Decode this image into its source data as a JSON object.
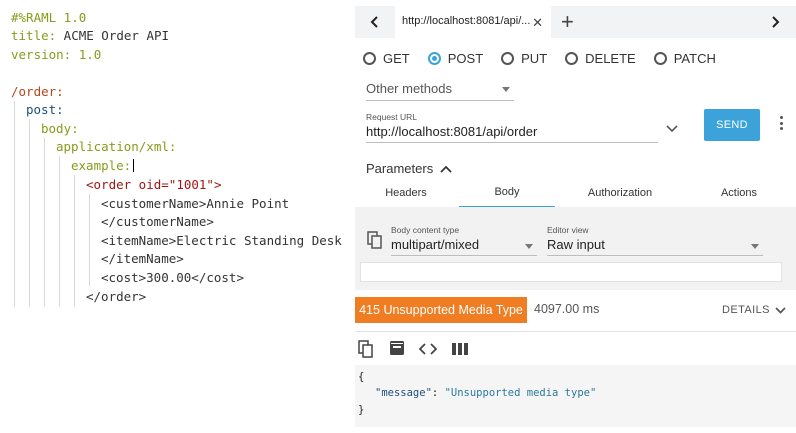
{
  "editor": {
    "lines": {
      "l1": "#%RAML 1.0",
      "l2_key": "title:",
      "l2_val": " ACME Order API",
      "l3_key": "version:",
      "l3_val": " 1.0",
      "l5": "/order:",
      "l6": "post:",
      "l7": "body:",
      "l8": "application/xml:",
      "l9": "example:",
      "l10_tag": "<order",
      "l10_attr": " oid=",
      "l10_val": "\"1001\">",
      "l11": "<customerName>Annie Point",
      "l12": "</customerName>",
      "l13": "<itemName>Electric Standing Desk",
      "l14": "</itemName>",
      "l15": "<cost>300.00</cost>",
      "l16": "</order>"
    }
  },
  "browser": {
    "tab_title": "http://localhost:8081/api/...",
    "tab_close": "✕",
    "new_tab": "+"
  },
  "request": {
    "methods": [
      "GET",
      "POST",
      "PUT",
      "DELETE",
      "PATCH"
    ],
    "selected_method": "POST",
    "other_methods": "Other methods",
    "url_label": "Request URL",
    "url": "http://localhost:8081/api/order",
    "send": "SEND",
    "parameters": "Parameters",
    "tabs": [
      "Headers",
      "Body",
      "Authorization",
      "Actions"
    ],
    "active_tab": "Body",
    "body_content_type_label": "Body content type",
    "body_content_type": "multipart/mixed",
    "editor_view_label": "Editor view",
    "editor_view": "Raw input"
  },
  "response": {
    "status": "415 Unsupported Media Type",
    "time": "4097.00 ms",
    "details": "DETAILS",
    "json_open": "{",
    "json_key": "\"message\"",
    "json_colon": ": ",
    "json_value": "\"Unsupported media type\"",
    "json_close": "}"
  },
  "colors": {
    "accent": "#3ba3d9",
    "status": "#f07d22"
  }
}
